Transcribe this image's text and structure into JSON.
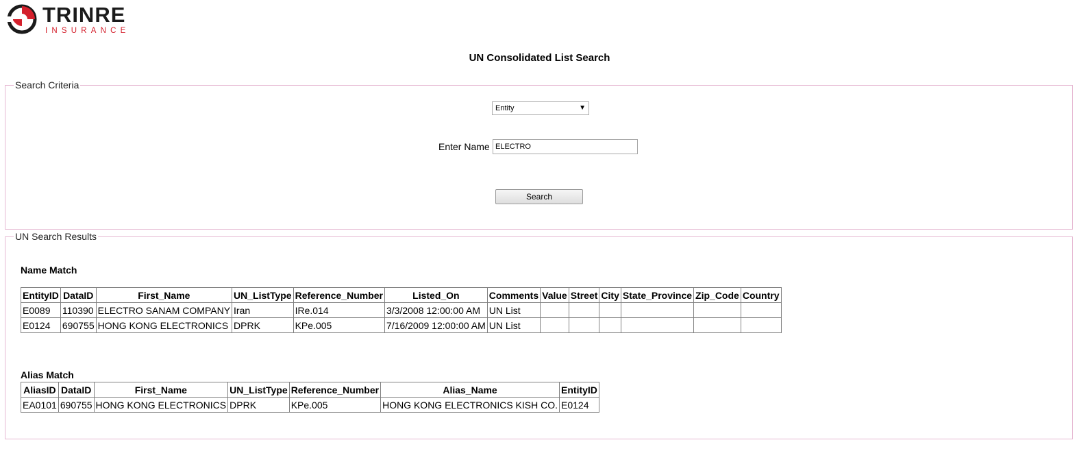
{
  "brand": {
    "name": "TRINRE",
    "subtitle": "INSURANCE",
    "color": "#d4202c"
  },
  "page_title": "UN Consolidated List Search",
  "criteria": {
    "legend": "Search Criteria",
    "type_select": {
      "value": "Entity",
      "icon": "dropdown-arrow-icon"
    },
    "name_label": "Enter Name",
    "name_value": "ELECTRO",
    "search_label": "Search"
  },
  "results": {
    "legend": "UN Search Results",
    "name_match": {
      "title": "Name Match",
      "columns": [
        "EntityID",
        "DataID",
        "First_Name",
        "UN_ListType",
        "Reference_Number",
        "Listed_On",
        "Comments",
        "Value",
        "Street",
        "City",
        "State_Province",
        "Zip_Code",
        "Country"
      ],
      "rows": [
        [
          "E0089",
          "110390",
          "ELECTRO SANAM COMPANY",
          "Iran",
          "IRe.014",
          "3/3/2008 12:00:00 AM",
          "UN List",
          "",
          "",
          "",
          "",
          "",
          ""
        ],
        [
          "E0124",
          "690755",
          "HONG KONG ELECTRONICS",
          "DPRK",
          "KPe.005",
          "7/16/2009 12:00:00 AM",
          "UN List",
          "",
          "",
          "",
          "",
          "",
          ""
        ]
      ]
    },
    "alias_match": {
      "title": "Alias Match",
      "columns": [
        "AliasID",
        "DataID",
        "First_Name",
        "UN_ListType",
        "Reference_Number",
        "Alias_Name",
        "EntityID"
      ],
      "rows": [
        [
          "EA0101",
          "690755",
          "HONG KONG ELECTRONICS",
          "DPRK",
          "KPe.005",
          "HONG KONG ELECTRONICS KISH CO.",
          "E0124"
        ]
      ]
    }
  }
}
